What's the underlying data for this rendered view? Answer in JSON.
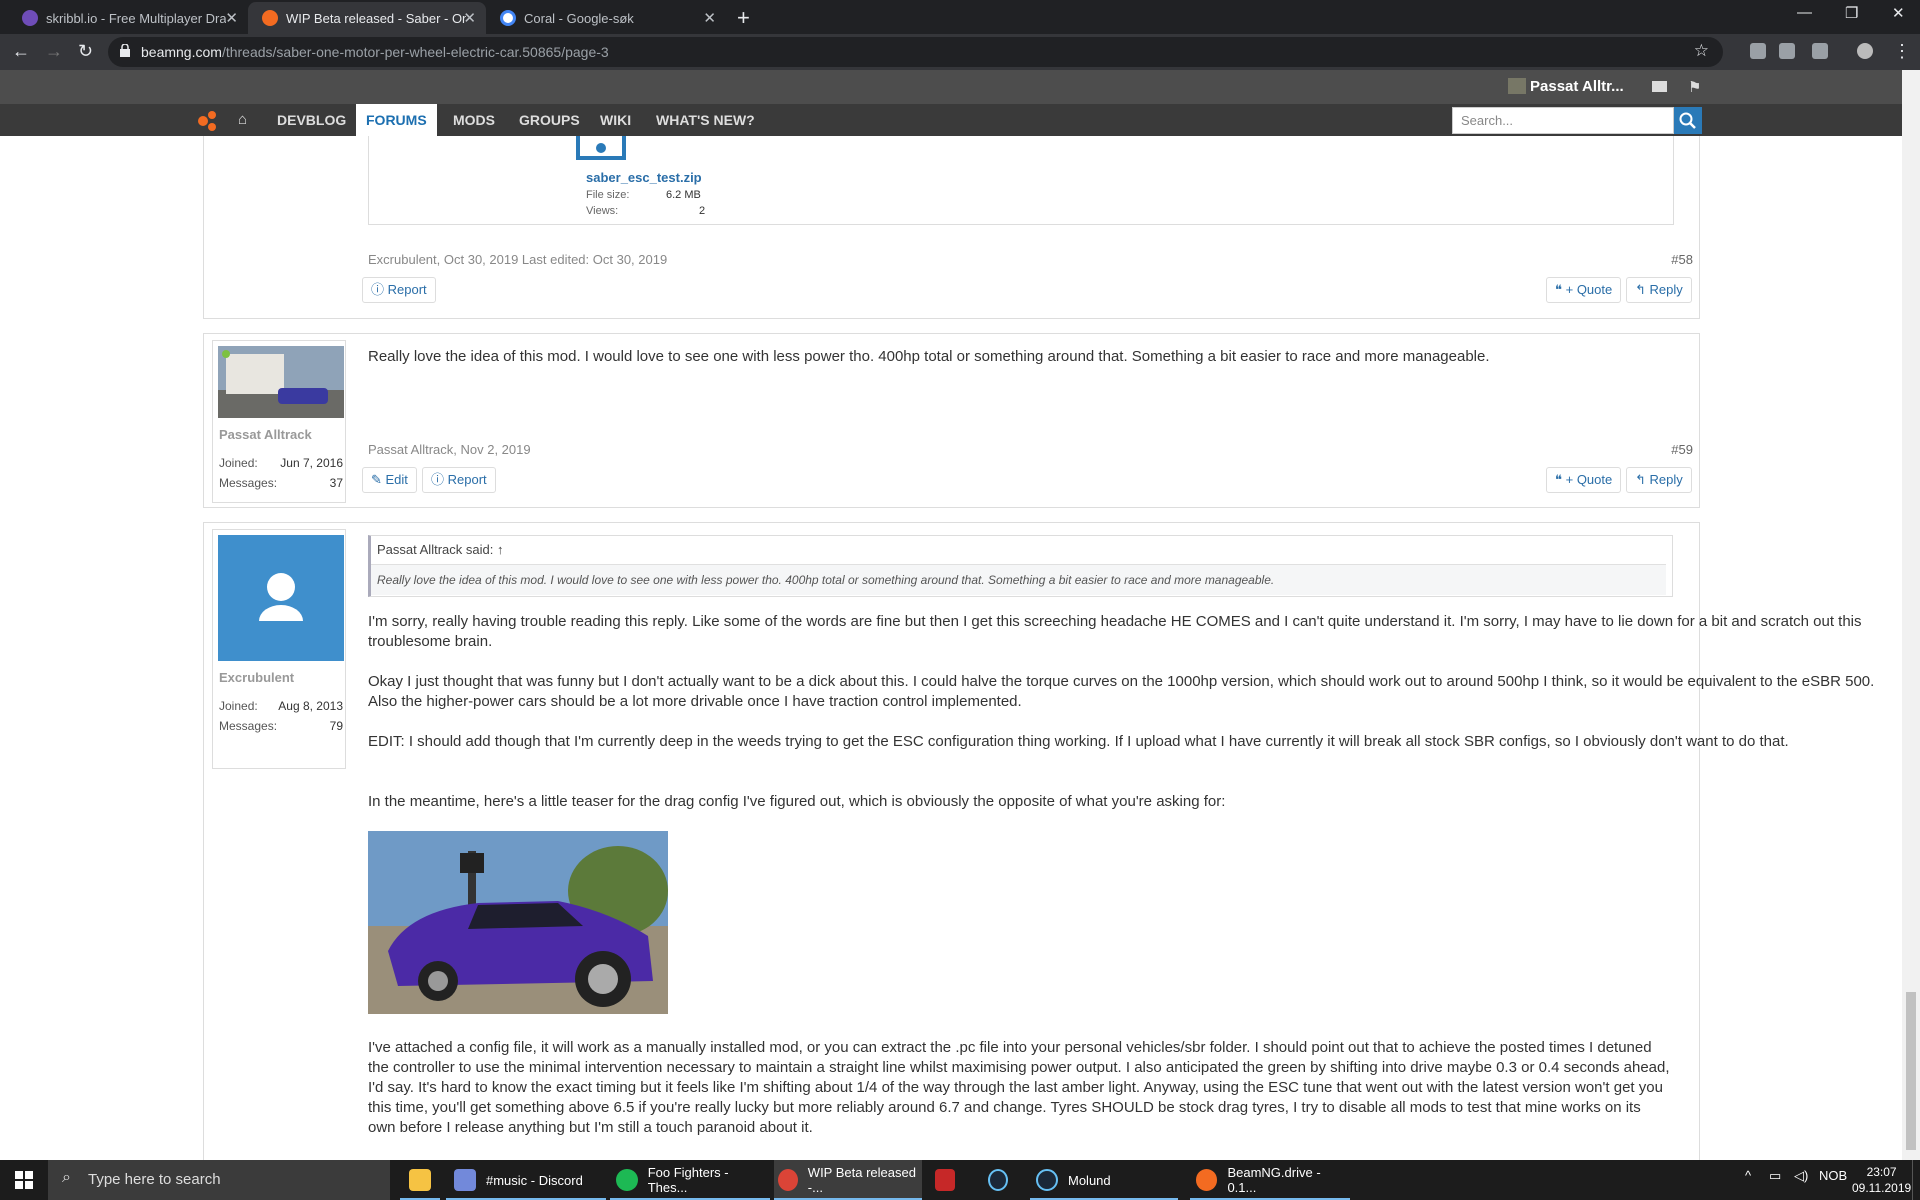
{
  "browser": {
    "tabs": [
      {
        "title": "skribbl.io - Free Multiplayer Draw",
        "favicon_color": "#6f4db8"
      },
      {
        "title": "WIP Beta released - Saber - One",
        "favicon_color": "#f36b21"
      },
      {
        "title": "Coral - Google-søk",
        "favicon_color": "#4285f4"
      }
    ],
    "url_host": "beamng.com",
    "url_path": "/threads/saber-one-motor-per-wheel-electric-car.50865/page-3"
  },
  "forum": {
    "username": "Passat Alltr...",
    "nav": [
      "DEVBLOG",
      "FORUMS",
      "MODS",
      "GROUPS",
      "WIKI",
      "WHAT'S NEW?"
    ],
    "active_nav": "FORUMS",
    "search_placeholder": "Search..."
  },
  "post58": {
    "attachment": {
      "filename": "saber_esc_test.zip",
      "size_label": "File size:",
      "size": "6.2 MB",
      "views_label": "Views:",
      "views": "2"
    },
    "meta": "Excrubulent, Oct 30, 2019   Last edited: Oct 30, 2019",
    "number": "#58",
    "report": "Report",
    "quote": "+ Quote",
    "reply": "Reply"
  },
  "post59": {
    "author": "Passat Alltrack",
    "joined_label": "Joined:",
    "joined": "Jun 7, 2016",
    "messages_label": "Messages:",
    "messages": "37",
    "text": "Really love the idea of this mod. I would love to see one with less power tho. 400hp total or something around that. Something a bit easier to race and more manageable.",
    "meta": "Passat Alltrack, Nov 2, 2019",
    "number": "#59",
    "edit": "Edit",
    "report": "Report",
    "quote": "+ Quote",
    "reply": "Reply"
  },
  "post60": {
    "author": "Excrubulent",
    "joined_label": "Joined:",
    "joined": "Aug 8, 2013",
    "messages_label": "Messages:",
    "messages": "79",
    "quote_head": "Passat Alltrack said: ↑",
    "quote_body": "Really love the idea of this mod. I would love to see one with less power tho. 400hp total or something around that. Something a bit easier to race and more manageable.",
    "p1": "I'm sorry, really having trouble reading this reply. Like some of the words are fine but then I get this screeching headache HE COMES and I can't quite understand it. I'm sorry, I may have to lie down for a bit and scratch out this troublesome brain.",
    "p2": "Okay I just thought that was funny but I don't actually want to be a dick about this. I could halve the torque curves on the 1000hp version, which should work out to around 500hp I think, so it would be equivalent to the eSBR 500. Also the higher-power cars should be a lot more drivable once I have traction control implemented.",
    "p3": "EDIT: I should add though that I'm currently deep in the weeds trying to get the ESC configuration thing working. If I upload what I have currently it will break all stock SBR configs, so I obviously don't want to do that.",
    "p4": "In the meantime, here's a little teaser for the drag config I've figured out, which is obviously the opposite of what you're asking for:",
    "p5": "I've attached a config file, it will work as a manually installed mod, or you can extract the .pc file into your personal vehicles/sbr folder. I should point out that to achieve the posted times I detuned the controller to use the minimal intervention necessary to maintain a straight line whilst maximising power output. I also anticipated the green by shifting into drive maybe 0.3 or 0.4 seconds ahead, I'd say. It's hard to know the exact timing but it feels like I'm shifting about 1/4 of the way through the last amber light. Anyway, using the ESC tune that went out with the latest version won't get you this time, you'll get something above 6.5 if you're really lucky but more reliably around 6.7 and change. Tyres SHOULD be stock drag tyres, I try to disable all mods to test that mine works on its own before I release anything but I'm still a touch paranoid about it."
  },
  "taskbar": {
    "search_placeholder": "Type here to search",
    "items": [
      "#music - Discord",
      "Foo Fighters - Thes...",
      "WIP Beta released -...",
      "Molund",
      "BeamNG.drive - 0.1..."
    ],
    "lang": "NOB",
    "time": "23:07",
    "date": "09.11.2019"
  },
  "colors": {
    "accent": "#1c6fb0",
    "brand": "#f36b21"
  }
}
